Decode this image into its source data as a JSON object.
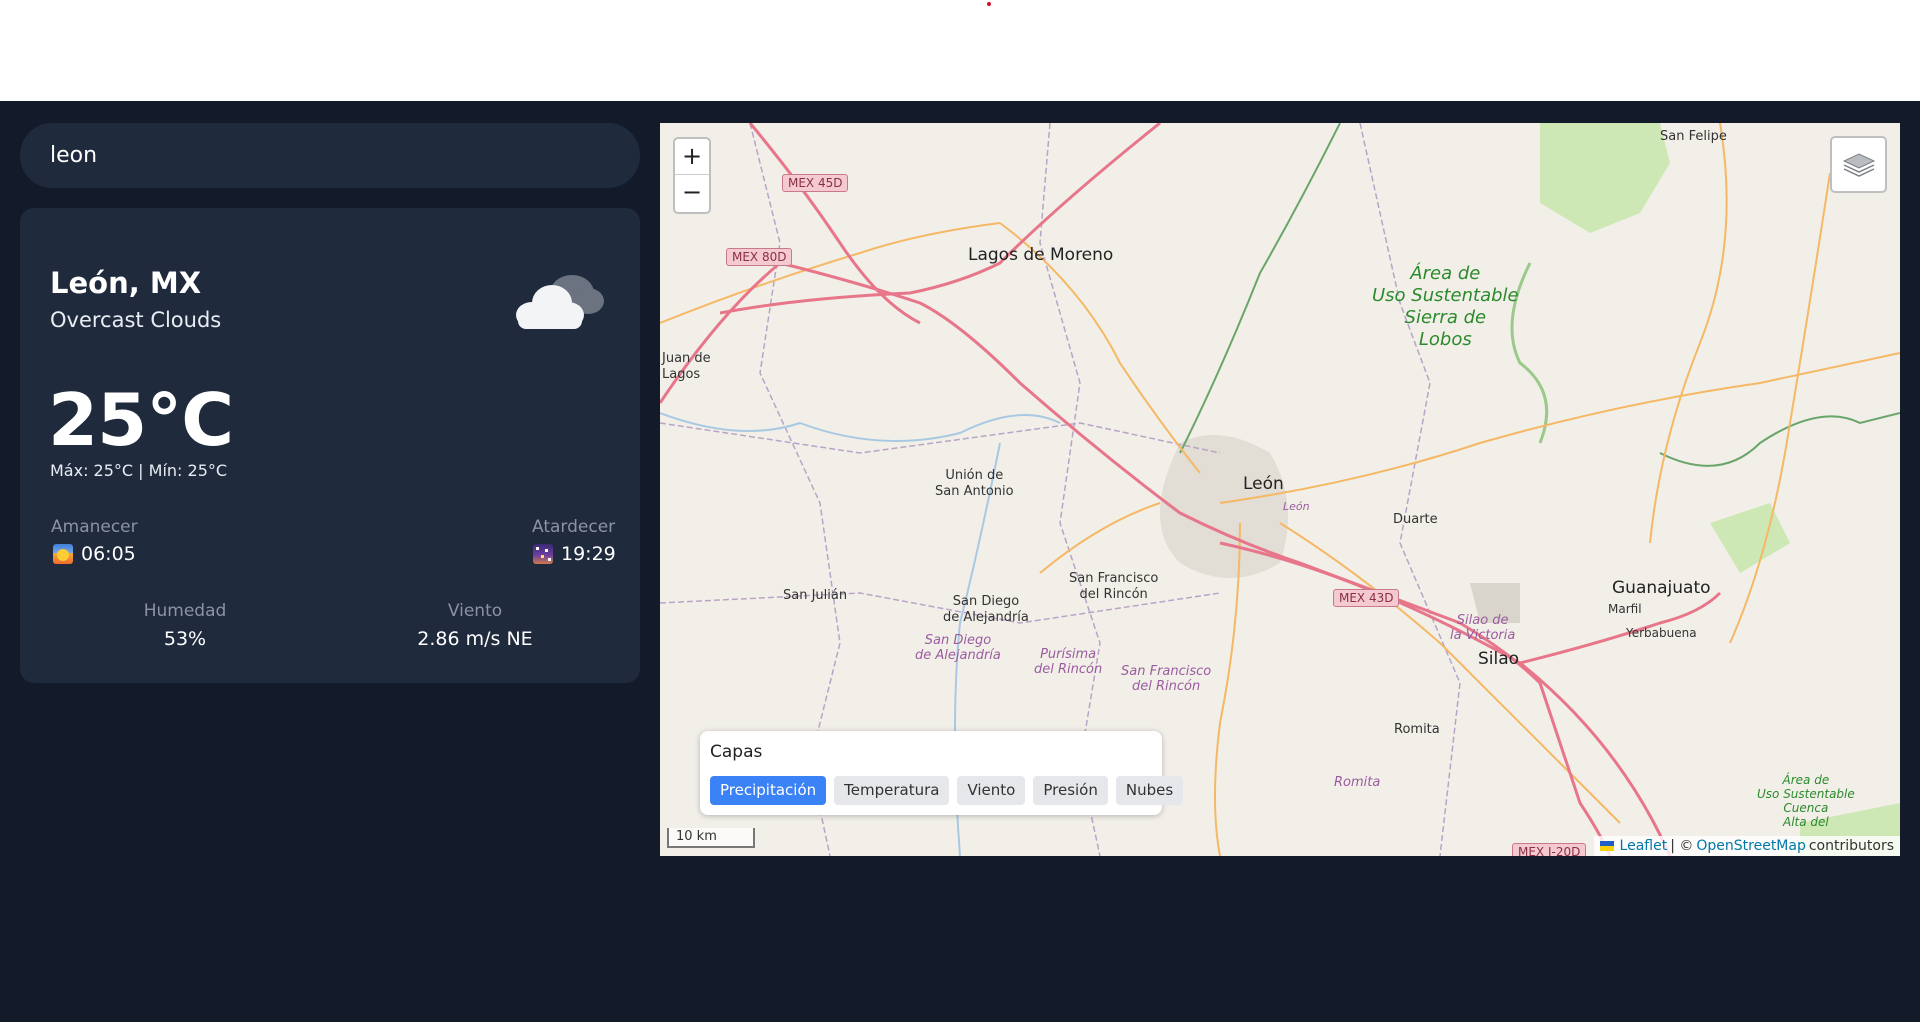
{
  "search": {
    "value": "leon"
  },
  "weather": {
    "city": "León, MX",
    "description": "Overcast Clouds",
    "icon": "overcast-clouds-icon",
    "temperature": "25°C",
    "minmax": "Máx: 25°C | Mín: 25°C",
    "sunrise_label": "Amanecer",
    "sunrise_time": "06:05",
    "sunset_label": "Atardecer",
    "sunset_time": "19:29",
    "humidity_label": "Humedad",
    "humidity_value": "53%",
    "wind_label": "Viento",
    "wind_value": "2.86 m/s NE"
  },
  "map": {
    "zoom_in": "+",
    "zoom_out": "−",
    "layers_title": "Capas",
    "layers": [
      "Precipitación",
      "Temperatura",
      "Viento",
      "Presión",
      "Nubes"
    ],
    "active_layer": "Precipitación",
    "scale": "10 km",
    "attribution": {
      "leaflet": "Leaflet",
      "sep": "| ©",
      "osm": "OpenStreetMap",
      "contributors": "contributors"
    },
    "places": {
      "lagos": "Lagos de Moreno",
      "san_felipe": "San Felipe",
      "juan_de_lagos_1": "Juan de",
      "juan_de_lagos_2": "Lagos",
      "union_1": "Unión de",
      "union_2": "San Antonio",
      "leon": "León",
      "leon_small": "León",
      "duarte": "Duarte",
      "guanajuato": "Guanajuato",
      "marfil": "Marfil",
      "yerbabuena": "Yerbabuena",
      "silao": "Silao",
      "silao_victoria_1": "Silao de",
      "silao_victoria_2": "la Victoria",
      "san_julian": "San Julián",
      "san_diego_1": "San Diego",
      "san_diego_2": "de Alejandría",
      "san_diego_mun_1": "San Diego",
      "san_diego_mun_2": "de Alejandría",
      "san_francisco_1": "San Francisco",
      "san_francisco_2": "del Rincón",
      "purisima_1": "Purísima",
      "purisima_2": "del Rincón",
      "san_francisco_mun_1": "San Francisco",
      "san_francisco_mun_2": "del Rincón",
      "romita": "Romita",
      "romita_mun": "Romita",
      "area_1": "Área de",
      "area_2": "Uso Sustentable",
      "area_3": "Sierra de",
      "area_4": "Lobos",
      "area_small_1": "Área de",
      "area_small_2": "Uso Sustentable",
      "area_small_3": "Cuenca",
      "area_small_4": "Alta del"
    },
    "shields": {
      "mex45d": "MEX 45D",
      "mex80d": "MEX 80D",
      "mex43d": "MEX 43D",
      "mexi20d": "MEX I-20D"
    }
  }
}
